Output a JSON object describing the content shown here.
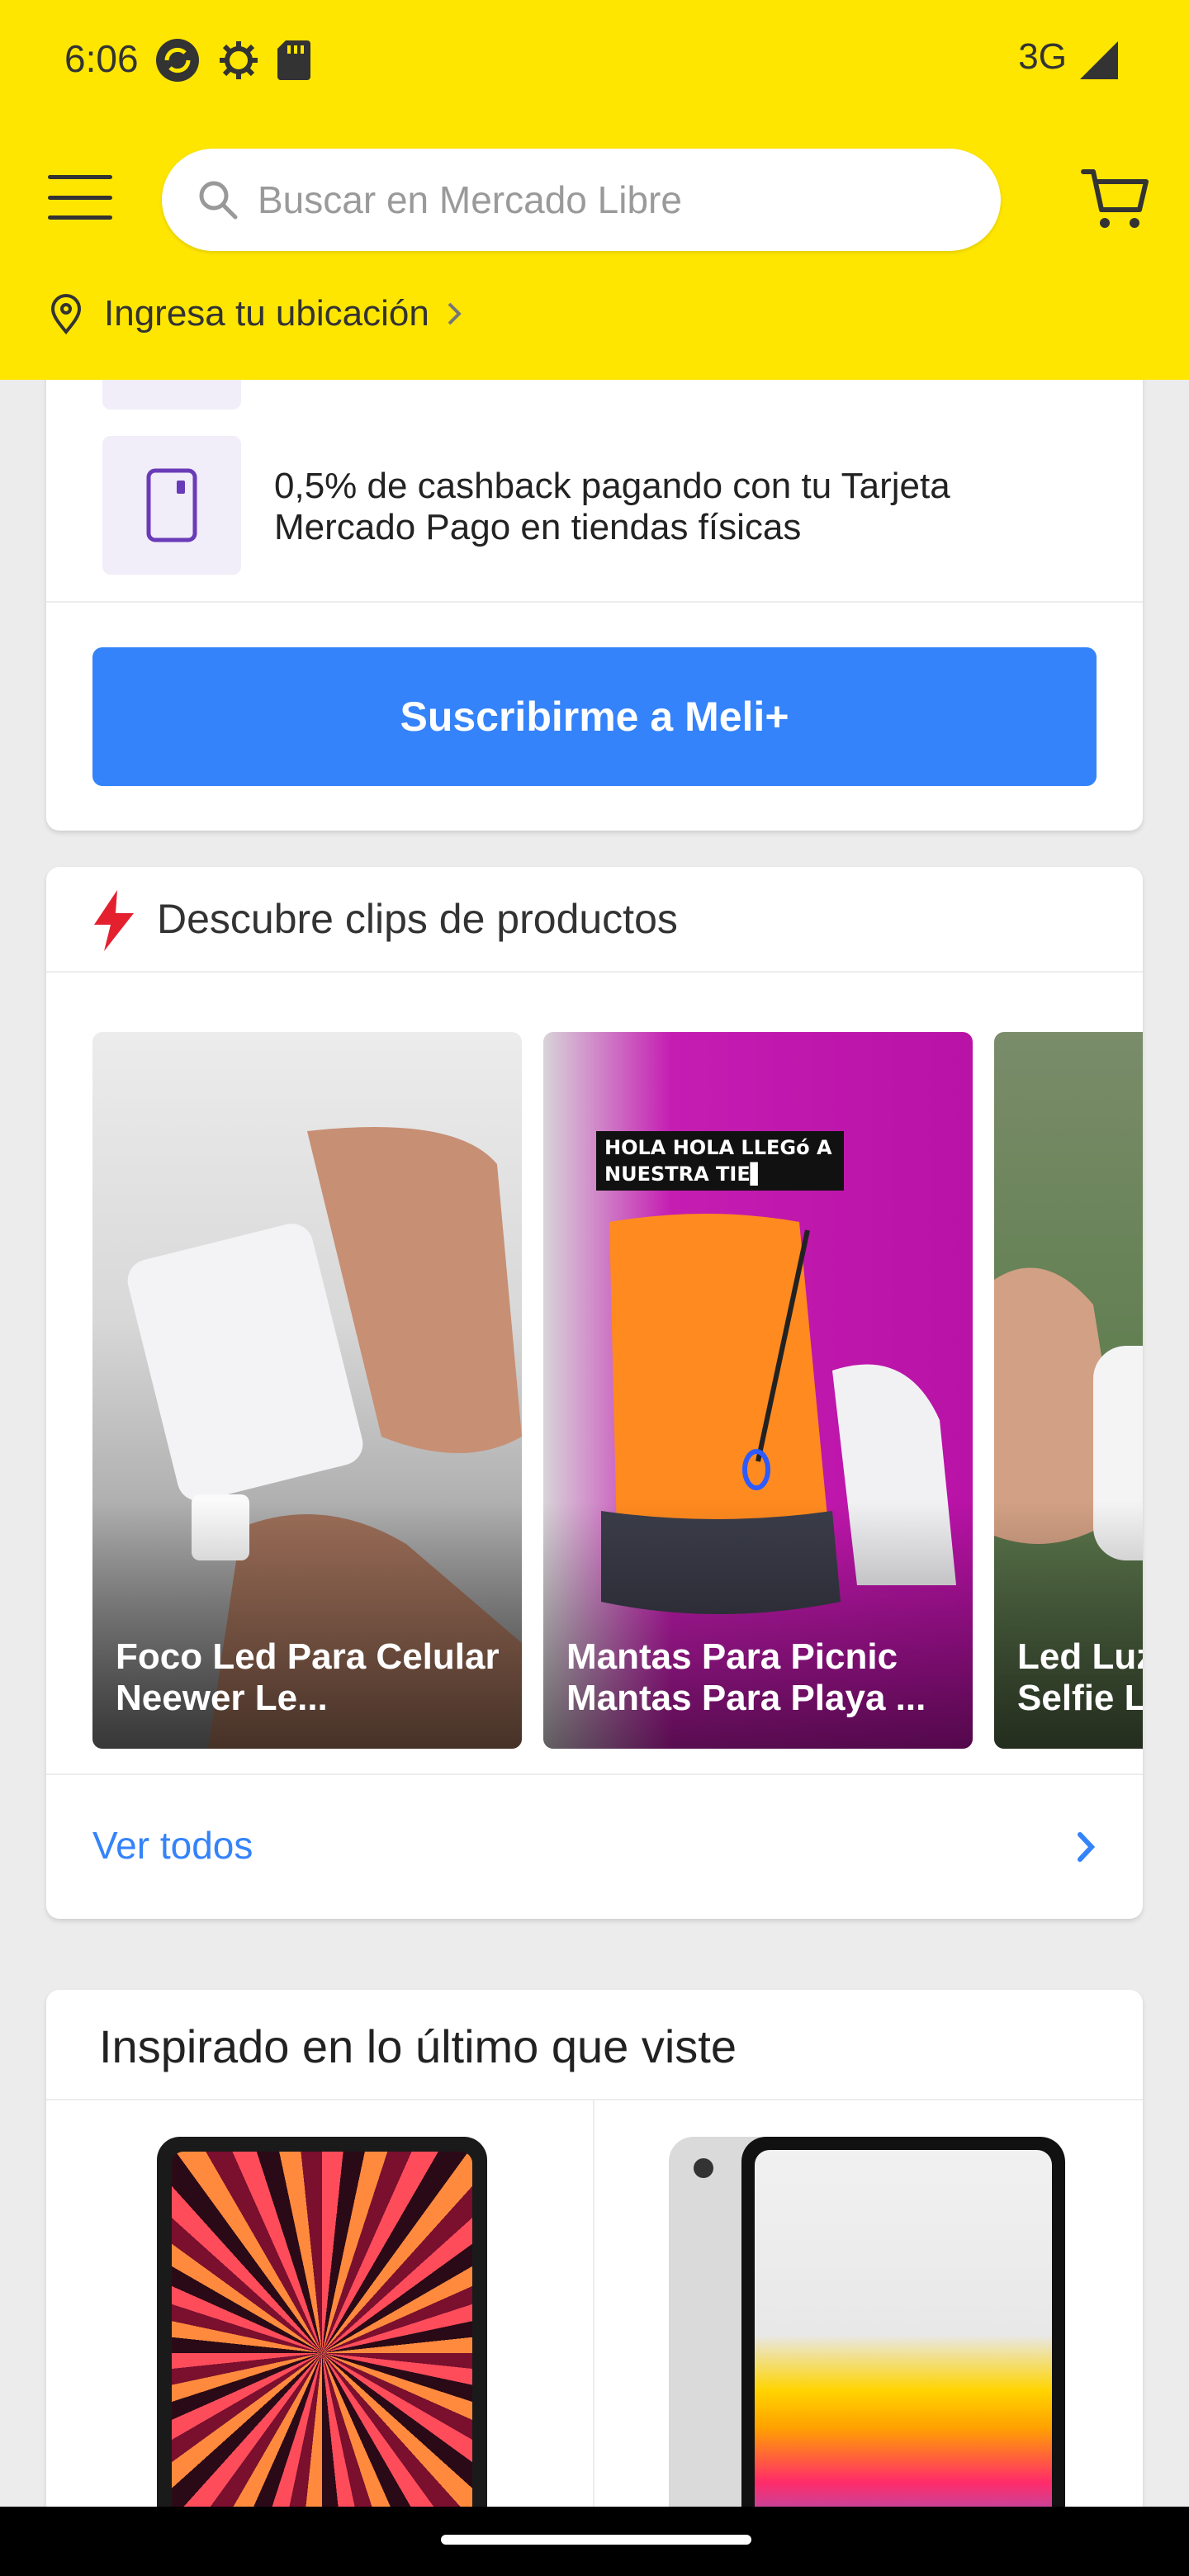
{
  "status_bar": {
    "time": "6:06",
    "network": "3G",
    "left_icons": [
      "sync-icon",
      "settings-icon",
      "sd-card-icon"
    ]
  },
  "header": {
    "search_placeholder": "Buscar en Mercado Libre",
    "location_text": "Ingresa tu ubicación",
    "brand_color": "#ffe600"
  },
  "meli_card": {
    "benefit_text": "0,5% de cashback pagando con tu Tarjeta Mercado Pago en tiendas físicas",
    "subscribe_label": "Suscribirme a Meli+",
    "accent_color": "#3483fa"
  },
  "clips_card": {
    "title": "Descubre clips de productos",
    "clips": [
      {
        "caption": "Foco Led Para Celular Neewer Le..."
      },
      {
        "caption": "Mantas Para Picnic Mantas Para Playa ...",
        "overlay": "HOLA HOLA LLEGó A NUESTRA TIE▌"
      },
      {
        "caption": "Led Luz D Selfie Luz"
      }
    ],
    "see_all_label": "Ver todos"
  },
  "inspired_card": {
    "title": "Inspirado en lo último que viste"
  }
}
